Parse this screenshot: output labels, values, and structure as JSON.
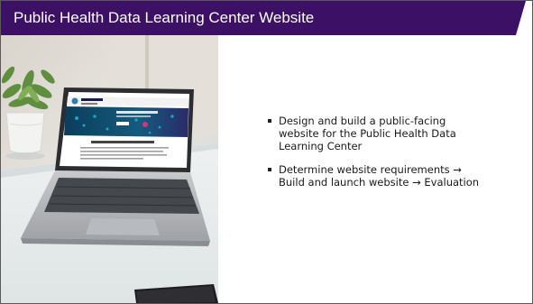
{
  "slide": {
    "title": "Public Health Data Learning Center Website",
    "accent_color": "#3c1065",
    "bullets": [
      "Design and build a public-facing website for the Public Health Data Learning Center",
      "Determine website requirements → Build and launch website → Evaluation"
    ]
  },
  "photo": {
    "subject": "laptop-on-glass-desk",
    "screen_header": "Public Health",
    "screen_hero": "Welcome! Great things are coming",
    "screen_body_title": "Welcome to the Public Health Data Learning Center"
  }
}
